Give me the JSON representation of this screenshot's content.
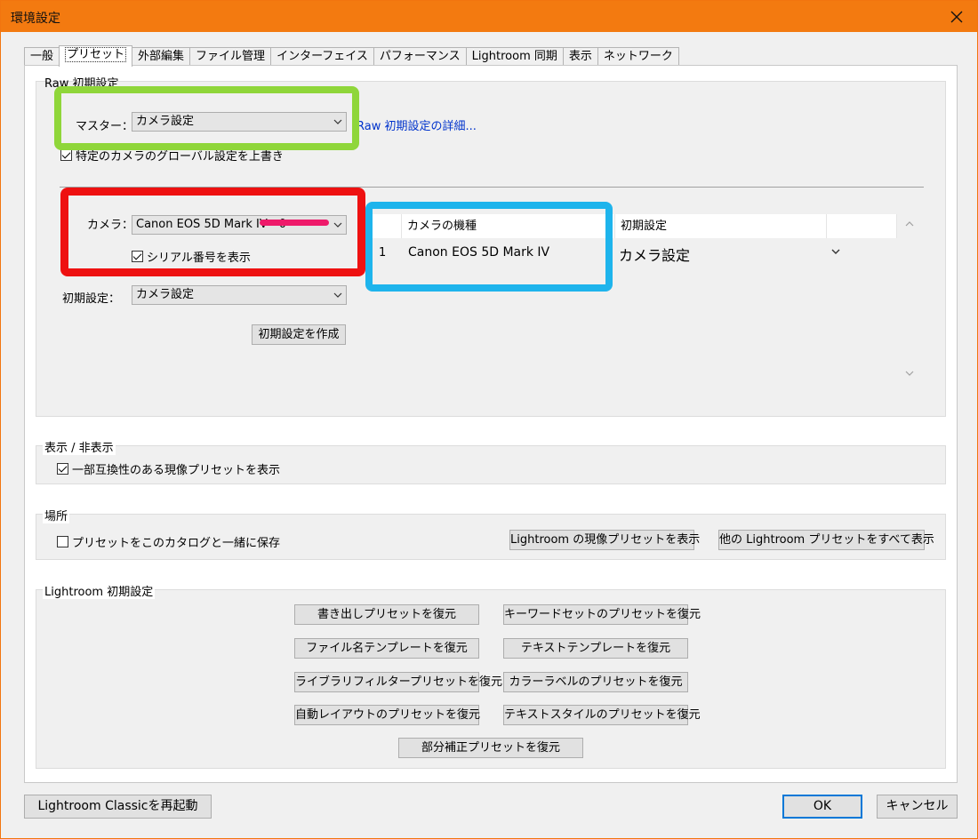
{
  "window": {
    "title": "環境設定"
  },
  "tabs": [
    "一般",
    "プリセット",
    "外部編集",
    "ファイル管理",
    "インターフェイス",
    "パフォーマンス",
    "Lightroom 同期",
    "表示",
    "ネットワーク"
  ],
  "raw": {
    "group_title": "Raw 初期設定",
    "master_label": "マスター：",
    "master_value": "カメラ設定",
    "details_link": "Raw 初期設定の詳細...",
    "override_label": "特定のカメラのグローバル設定を上書き",
    "camera_label": "カメラ：",
    "camera_value": "Canon EOS 5D Mark IV - 0",
    "serial_label": "シリアル番号を表示",
    "default_label": "初期設定：",
    "default_value": "カメラ設定",
    "create_button": "初期設定を作成",
    "table": {
      "col_model": "カメラの機種",
      "col_default": "初期設定",
      "rows": [
        {
          "num": "1",
          "model": "Canon EOS 5D Mark IV",
          "default": "カメラ設定"
        }
      ]
    }
  },
  "visibility": {
    "group_title": "表示 / 非表示",
    "checkbox_label": "一部互換性のある現像プリセットを表示"
  },
  "location": {
    "group_title": "場所",
    "checkbox_label": "プリセットをこのカタログと一緒に保存",
    "show_develop_button": "Lightroom の現像プリセットを表示",
    "show_all_button": "他の Lightroom プリセットをすべて表示"
  },
  "lightroom_defaults": {
    "group_title": "Lightroom 初期設定",
    "buttons": [
      "書き出しプリセットを復元",
      "キーワードセットのプリセットを復元",
      "ファイル名テンプレートを復元",
      "テキストテンプレートを復元",
      "ライブラリフィルタープリセットを復元",
      "カラーラベルのプリセットを復元",
      "自動レイアウトのプリセットを復元",
      "テキストスタイルのプリセットを復元",
      "部分補正プリセットを復元"
    ]
  },
  "footer": {
    "restart_button": "Lightroom Classicを再起動",
    "ok_button": "OK",
    "cancel_button": "キャンセル"
  },
  "colors": {
    "titlebar": "#f37a10",
    "highlight_green": "#8fd63a",
    "highlight_red": "#ee1111",
    "highlight_blue": "#1eb4ec",
    "redaction": "#ee1a6a"
  }
}
